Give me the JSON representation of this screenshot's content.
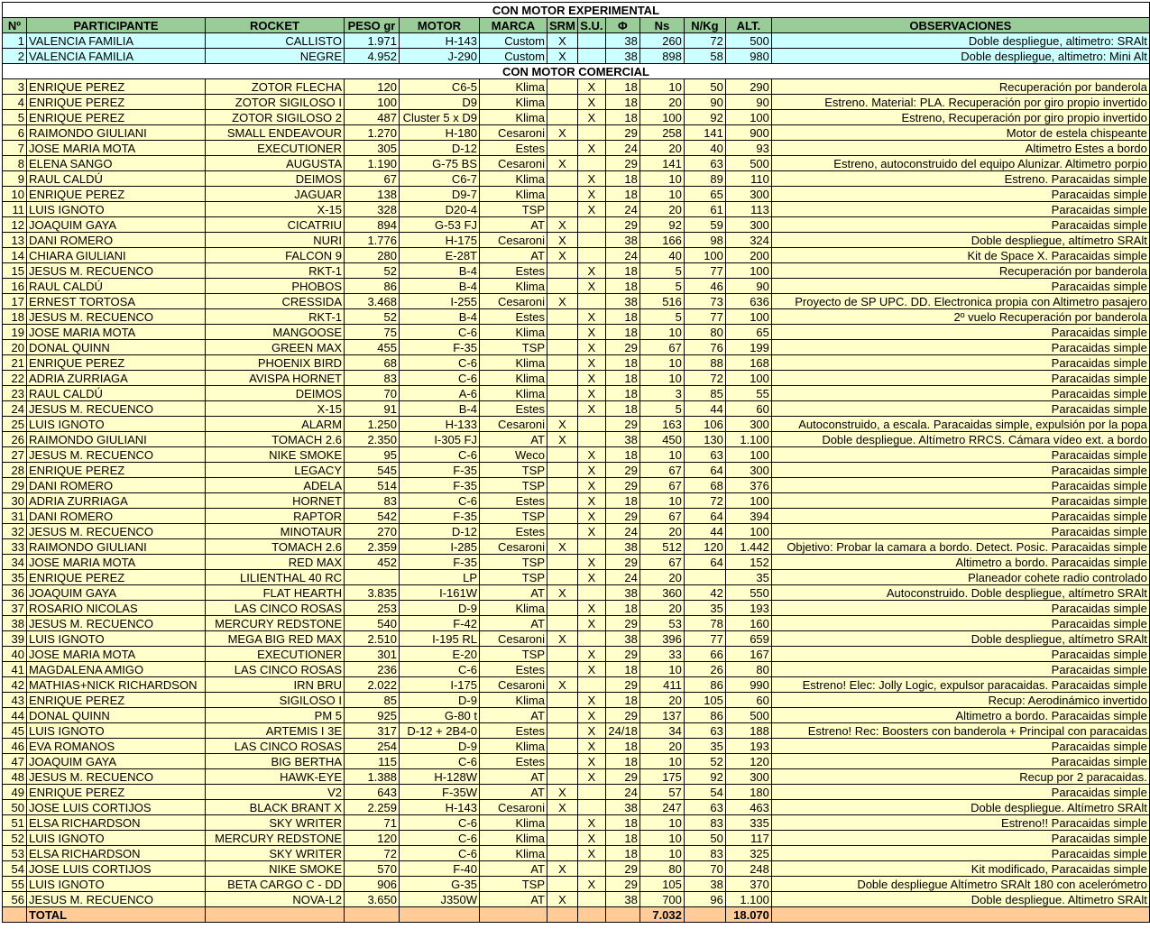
{
  "section_experimental": "CON MOTOR EXPERIMENTAL",
  "section_commercial": "CON MOTOR COMERCIAL",
  "headers": [
    "Nº",
    "PARTICIPANTE",
    "ROCKET",
    "PESO gr",
    "MOTOR",
    "MARCA",
    "SRM",
    "S.U.",
    "Φ",
    "Ns",
    "N/Kg",
    "ALT.",
    "OBSERVACIONES"
  ],
  "experimental_rows": [
    [
      "1",
      "VALENCIA FAMILIA",
      "CALLISTO",
      "1.971",
      "H-143",
      "Custom",
      "X",
      "",
      "38",
      "260",
      "72",
      "500",
      "Doble despliegue, altimetro: SRAlt"
    ],
    [
      "2",
      "VALENCIA FAMILIA",
      "NEGRE",
      "4.952",
      "J-290",
      "Custom",
      "X",
      "",
      "38",
      "898",
      "58",
      "980",
      "Doble despliegue, altimetro: Mini Alt"
    ]
  ],
  "commercial_rows": [
    [
      "3",
      "ENRIQUE PEREZ",
      "ZOTOR FLECHA",
      "120",
      "C6-5",
      "Klima",
      "",
      "X",
      "18",
      "10",
      "50",
      "290",
      "Recuperación por banderola"
    ],
    [
      "4",
      "ENRIQUE PEREZ",
      "ZOTOR SIGILOSO I",
      "100",
      "D9",
      "Klima",
      "",
      "X",
      "18",
      "20",
      "90",
      "90",
      "Estreno. Material: PLA. Recuperación por giro propio invertido"
    ],
    [
      "5",
      "ENRIQUE PEREZ",
      "ZOTOR SIGILOSO 2",
      "487",
      "Cluster 5 x D9",
      "Klima",
      "",
      "X",
      "18",
      "100",
      "92",
      "100",
      "Estreno, Recuperación por giro propio invertido"
    ],
    [
      "6",
      "RAIMONDO GIULIANI",
      "SMALL ENDEAVOUR",
      "1.270",
      "H-180",
      "Cesaroni",
      "X",
      "",
      "29",
      "258",
      "141",
      "900",
      "Motor de estela chispeante"
    ],
    [
      "7",
      "JOSE MARIA MOTA",
      "EXECUTIONER",
      "305",
      "D-12",
      "Estes",
      "",
      "X",
      "24",
      "20",
      "40",
      "93",
      "Altimetro Estes a bordo"
    ],
    [
      "8",
      "ELENA SANGO",
      "AUGUSTA",
      "1.190",
      "G-75 BS",
      "Cesaroni",
      "X",
      "",
      "29",
      "141",
      "63",
      "500",
      "Estreno, autoconstruido del equipo Alunizar. Altimetro porpio"
    ],
    [
      "9",
      "RAUL CALDÚ",
      "DEIMOS",
      "67",
      "C6-7",
      "Klima",
      "",
      "X",
      "18",
      "10",
      "89",
      "110",
      "Estreno. Paracaidas simple"
    ],
    [
      "10",
      "ENRIQUE PEREZ",
      "JAGUAR",
      "138",
      "D9-7",
      "Klima",
      "",
      "X",
      "18",
      "10",
      "65",
      "300",
      "Paracaidas simple"
    ],
    [
      "11",
      "LUIS IGNOTO",
      "X-15",
      "328",
      "D20-4",
      "TSP",
      "",
      "X",
      "24",
      "20",
      "61",
      "113",
      "Paracaidas simple"
    ],
    [
      "12",
      "JOAQUIM GAYA",
      "CICATRIU",
      "894",
      "G-53 FJ",
      "AT",
      "X",
      "",
      "29",
      "92",
      "59",
      "300",
      "Paracaidas simple"
    ],
    [
      "13",
      "DANI ROMERO",
      "NURI",
      "1.776",
      "H-175",
      "Cesaroni",
      "X",
      "",
      "38",
      "166",
      "98",
      "324",
      "Doble despliegue, altímetro SRAlt"
    ],
    [
      "14",
      "CHIARA GIULIANI",
      "FALCON 9",
      "280",
      "E-28T",
      "AT",
      "X",
      "",
      "24",
      "40",
      "100",
      "200",
      "Kit de Space X. Paracaidas simple"
    ],
    [
      "15",
      "JESUS M. RECUENCO",
      "RKT-1",
      "52",
      "B-4",
      "Estes",
      "",
      "X",
      "18",
      "5",
      "77",
      "100",
      "Recuperación por banderola"
    ],
    [
      "16",
      "RAUL CALDÚ",
      "PHOBOS",
      "86",
      "B-4",
      "Klima",
      "",
      "X",
      "18",
      "5",
      "46",
      "90",
      "Paracaidas simple"
    ],
    [
      "17",
      "ERNEST TORTOSA",
      "CRESSIDA",
      "3.468",
      "I-255",
      "Cesaroni",
      "X",
      "",
      "38",
      "516",
      "73",
      "636",
      "Proyecto de SP UPC. DD. Electronica propia con Altimetro pasajero"
    ],
    [
      "18",
      "JESUS M. RECUENCO",
      "RKT-1",
      "52",
      "B-4",
      "Estes",
      "",
      "X",
      "18",
      "5",
      "77",
      "100",
      "2º vuelo  Recuperación por banderola"
    ],
    [
      "19",
      "JOSE MARIA MOTA",
      "MANGOOSE",
      "75",
      "C-6",
      "Klima",
      "",
      "X",
      "18",
      "10",
      "80",
      "65",
      "Paracaidas simple"
    ],
    [
      "20",
      "DONAL QUINN",
      "GREEN MAX",
      "455",
      "F-35",
      "TSP",
      "",
      "X",
      "29",
      "67",
      "76",
      "199",
      "Paracaidas simple"
    ],
    [
      "21",
      "ENRIQUE PEREZ",
      "PHOENIX BIRD",
      "68",
      "C-6",
      "Klima",
      "",
      "X",
      "18",
      "10",
      "88",
      "168",
      "Paracaidas simple"
    ],
    [
      "22",
      "ADRIA ZURRIAGA",
      "AVISPA HORNET",
      "83",
      "C-6",
      "Klima",
      "",
      "X",
      "18",
      "10",
      "72",
      "100",
      "Paracaidas simple"
    ],
    [
      "23",
      "RAUL CALDÚ",
      "DEIMOS",
      "70",
      "A-6",
      "Klima",
      "",
      "X",
      "18",
      "3",
      "85",
      "55",
      "Paracaidas simple"
    ],
    [
      "24",
      "JESUS M. RECUENCO",
      "X-15",
      "91",
      "B-4",
      "Estes",
      "",
      "X",
      "18",
      "5",
      "44",
      "60",
      "Paracaidas simple"
    ],
    [
      "25",
      "LUIS IGNOTO",
      "ALARM",
      "1.250",
      "H-133",
      "Cesaroni",
      "X",
      "",
      "29",
      "163",
      "106",
      "300",
      "Autoconstruido, a escala. Paracaidas simple, expulsión por la popa"
    ],
    [
      "26",
      "RAIMONDO GIULIANI",
      "TOMACH 2.6",
      "2.350",
      "I-305 FJ",
      "AT",
      "X",
      "",
      "38",
      "450",
      "130",
      "1.100",
      "Doble despliegue. Altímetro RRCS. Cámara vídeo ext. a bordo"
    ],
    [
      "27",
      "JESUS M. RECUENCO",
      "NIKE SMOKE",
      "95",
      "C-6",
      "Weco",
      "",
      "X",
      "18",
      "10",
      "63",
      "100",
      "Paracaidas simple"
    ],
    [
      "28",
      "ENRIQUE PEREZ",
      "LEGACY",
      "545",
      "F-35",
      "TSP",
      "",
      "X",
      "29",
      "67",
      "64",
      "300",
      "Paracaidas simple"
    ],
    [
      "29",
      "DANI ROMERO",
      "ADELA",
      "514",
      "F-35",
      "TSP",
      "",
      "X",
      "29",
      "67",
      "68",
      "376",
      "Paracaidas simple"
    ],
    [
      "30",
      "ADRIA ZURRIAGA",
      "HORNET",
      "83",
      "C-6",
      "Estes",
      "",
      "X",
      "18",
      "10",
      "72",
      "100",
      "Paracaidas simple"
    ],
    [
      "31",
      "DANI ROMERO",
      "RAPTOR",
      "542",
      "F-35",
      "TSP",
      "",
      "X",
      "29",
      "67",
      "64",
      "394",
      "Paracaidas simple"
    ],
    [
      "32",
      "JESUS M. RECUENCO",
      "MINOTAUR",
      "270",
      "D-12",
      "Estes",
      "",
      "X",
      "24",
      "20",
      "44",
      "100",
      "Paracaidas simple"
    ],
    [
      "33",
      "RAIMONDO GIULIANI",
      "TOMACH 2.6",
      "2.359",
      "I-285",
      "Cesaroni",
      "X",
      "",
      "38",
      "512",
      "120",
      "1.442",
      "Objetivo: Probar la camara a bordo. Detect. Posic. Paracaidas simple"
    ],
    [
      "34",
      "JOSE MARIA MOTA",
      "RED MAX",
      "452",
      "F-35",
      "TSP",
      "",
      "X",
      "29",
      "67",
      "64",
      "152",
      "Altimetro a bordo. Paracaidas simple"
    ],
    [
      "35",
      "ENRIQUE PEREZ",
      "LILIENTHAL 40 RC",
      "",
      "LP",
      "TSP",
      "",
      "X",
      "24",
      "20",
      "",
      "35",
      "Planeador cohete radio controlado"
    ],
    [
      "36",
      "JOAQUIM GAYA",
      "FLAT HEARTH",
      "3.835",
      "I-161W",
      "AT",
      "X",
      "",
      "38",
      "360",
      "42",
      "550",
      "Autoconstruido. Doble despliegue, altímetro SRAlt"
    ],
    [
      "37",
      "ROSARIO NICOLAS",
      "LAS CINCO ROSAS",
      "253",
      "D-9",
      "Klima",
      "",
      "X",
      "18",
      "20",
      "35",
      "193",
      "Paracaidas simple"
    ],
    [
      "38",
      "JESUS M. RECUENCO",
      "MERCURY REDSTONE",
      "540",
      "F-42",
      "AT",
      "",
      "X",
      "29",
      "53",
      "78",
      "160",
      "Paracaidas simple"
    ],
    [
      "39",
      "LUIS IGNOTO",
      "MEGA BIG RED MAX",
      "2.510",
      "I-195 RL",
      "Cesaroni",
      "X",
      "",
      "38",
      "396",
      "77",
      "659",
      "Doble despliegue, altímetro SRAlt"
    ],
    [
      "40",
      "JOSE MARIA MOTA",
      "EXECUTIONER",
      "301",
      "E-20",
      "TSP",
      "",
      "X",
      "29",
      "33",
      "66",
      "167",
      "Paracaidas simple"
    ],
    [
      "41",
      "MAGDALENA AMIGO",
      "LAS CINCO ROSAS",
      "236",
      "C-6",
      "Estes",
      "",
      "X",
      "18",
      "10",
      "26",
      "80",
      "Paracaidas simple"
    ],
    [
      "42",
      "MATHIAS+NICK RICHARDSON",
      "IRN BRU",
      "2.022",
      "I-175",
      "Cesaroni",
      "X",
      "",
      "29",
      "411",
      "86",
      "990",
      "Estreno!  Elec: Jolly Logic, expulsor paracaidas. Paracaidas simple"
    ],
    [
      "43",
      "ENRIQUE PEREZ",
      "SIGILOSO I",
      "85",
      "D-9",
      "Klima",
      "",
      "X",
      "18",
      "20",
      "105",
      "60",
      "Recup: Aerodinámico invertido"
    ],
    [
      "44",
      "DONAL QUINN",
      "PM 5",
      "925",
      "G-80 t",
      "AT",
      "",
      "X",
      "29",
      "137",
      "86",
      "500",
      "Altimetro a bordo. Paracaidas simple"
    ],
    [
      "45",
      "LUIS IGNOTO",
      "ARTEMIS I 3E",
      "317",
      "D-12 + 2B4-0",
      "Estes",
      "",
      "X",
      "24/18",
      "34",
      "63",
      "188",
      "Estreno! Rec: Boosters con banderola + Principal con paracaidas"
    ],
    [
      "46",
      "EVA ROMANOS",
      "LAS CINCO ROSAS",
      "254",
      "D-9",
      "Klima",
      "",
      "X",
      "18",
      "20",
      "35",
      "193",
      "Paracaidas simple"
    ],
    [
      "47",
      "JOAQUIM GAYA",
      "BIG BERTHA",
      "115",
      "C-6",
      "Estes",
      "",
      "X",
      "18",
      "10",
      "52",
      "120",
      "Paracaidas simple"
    ],
    [
      "48",
      "JESUS M. RECUENCO",
      "HAWK-EYE",
      "1.388",
      "H-128W",
      "AT",
      "",
      "X",
      "29",
      "175",
      "92",
      "300",
      "Recup por 2 paracaidas."
    ],
    [
      "49",
      "ENRIQUE PEREZ",
      "V2",
      "643",
      "F-35W",
      "AT",
      "X",
      "",
      "24",
      "57",
      "54",
      "180",
      "Paracaidas simple"
    ],
    [
      "50",
      "JOSE LUIS CORTIJOS",
      "BLACK BRANT X",
      "2.259",
      "H-143",
      "Cesaroni",
      "X",
      "",
      "38",
      "247",
      "63",
      "463",
      "Doble despliegue. Altímetro SRAlt"
    ],
    [
      "51",
      "ELSA RICHARDSON",
      "SKY WRITER",
      "71",
      "C-6",
      "Klima",
      "",
      "X",
      "18",
      "10",
      "83",
      "335",
      "Estreno!!  Paracaidas simple"
    ],
    [
      "52",
      "LUIS IGNOTO",
      "MERCURY REDSTONE",
      "120",
      "C-6",
      "Klima",
      "",
      "X",
      "18",
      "10",
      "50",
      "117",
      "Paracaidas simple"
    ],
    [
      "53",
      "ELSA RICHARDSON",
      "SKY WRITER",
      "72",
      "C-6",
      "Klima",
      "",
      "X",
      "18",
      "10",
      "83",
      "325",
      "Paracaidas simple"
    ],
    [
      "54",
      "JOSE LUIS CORTIJOS",
      "NIKE SMOKE",
      "570",
      "F-40",
      "AT",
      "X",
      "",
      "29",
      "80",
      "70",
      "248",
      "Kit modificado, Paracaidas simple"
    ],
    [
      "55",
      "LUIS IGNOTO",
      "BETA CARGO C - DD",
      "906",
      "G-35",
      "TSP",
      "",
      "X",
      "29",
      "105",
      "38",
      "370",
      "Doble despliegue Altímetro SRAlt 180  con acelerómetro"
    ],
    [
      "56",
      "JESUS M. RECUENCO",
      "NOVA-L2",
      "3.650",
      "J350W",
      "AT",
      "X",
      "",
      "38",
      "700",
      "96",
      "1.100",
      "Doble despliegue. Altimetro SRAlt"
    ]
  ],
  "total": {
    "label": "TOTAL",
    "ns": "7.032",
    "alt": "18.070"
  }
}
